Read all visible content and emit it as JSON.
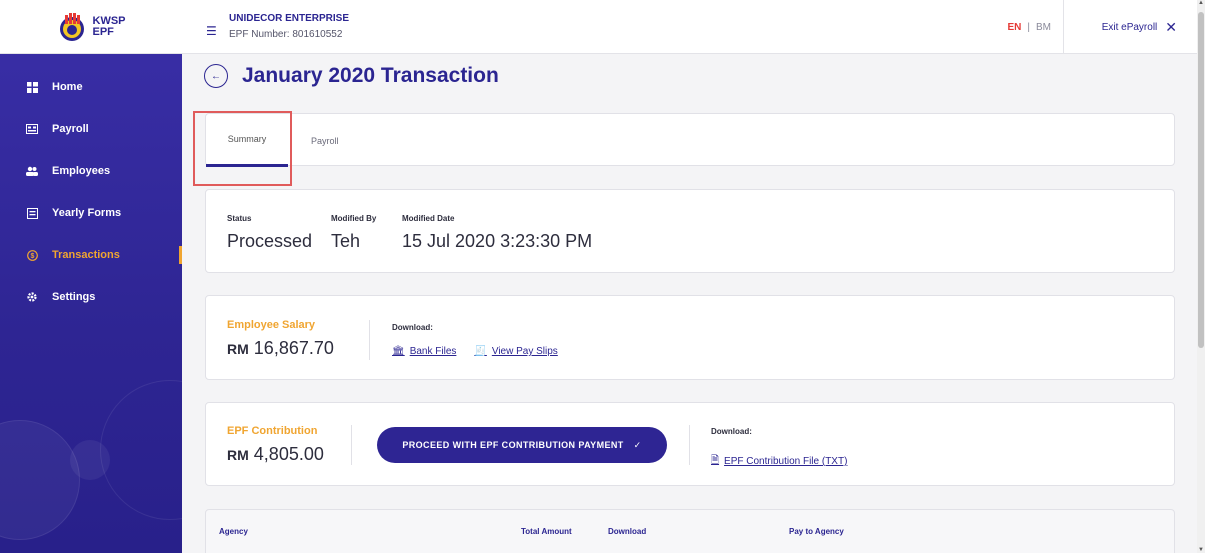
{
  "logo": {
    "line1": "KWSP",
    "line2": "EPF"
  },
  "sidebar": {
    "items": [
      {
        "label": "Home",
        "icon": "dashboard-icon"
      },
      {
        "label": "Payroll",
        "icon": "payroll-icon"
      },
      {
        "label": "Employees",
        "icon": "people-icon"
      },
      {
        "label": "Yearly Forms",
        "icon": "form-icon"
      },
      {
        "label": "Transactions",
        "icon": "transactions-icon",
        "active": true
      },
      {
        "label": "Settings",
        "icon": "gear-icon"
      }
    ]
  },
  "topbar": {
    "company_name": "UNIDECOR ENTERPRISE",
    "epf_number": "EPF Number: 801610552",
    "lang_en": "EN",
    "lang_sep": "|",
    "lang_bm": "BM",
    "exit_label": "Exit ePayroll",
    "exit_icon": "✕"
  },
  "page": {
    "title": "January 2020 Transaction"
  },
  "tabs": [
    {
      "label": "Summary",
      "active": true
    },
    {
      "label": "Payroll",
      "active": false
    }
  ],
  "status": {
    "status_label": "Status",
    "status_value": "Processed",
    "modified_by_label": "Modified By",
    "modified_by_value": "Teh",
    "modified_date_label": "Modified Date",
    "modified_date_value": "15 Jul 2020 3:23:30 PM"
  },
  "salary": {
    "label": "Employee Salary",
    "currency": "RM",
    "amount": "16,867.70",
    "download_label": "Download:",
    "bank_files": "Bank Files",
    "pay_slips": "View Pay Slips"
  },
  "epf": {
    "label": "EPF Contribution",
    "currency": "RM",
    "amount": "4,805.00",
    "proceed_label": "PROCEED WITH EPF CONTRIBUTION PAYMENT",
    "proceed_icon": "✓",
    "download_label": "Download:",
    "file_link": "EPF Contribution File (TXT)"
  },
  "table": {
    "headers": [
      "Agency",
      "Total Amount",
      "Download",
      "Pay to Agency"
    ]
  },
  "colors": {
    "brand": "#2b2591",
    "accent": "#f0a531",
    "highlight": "#e05b5b"
  }
}
